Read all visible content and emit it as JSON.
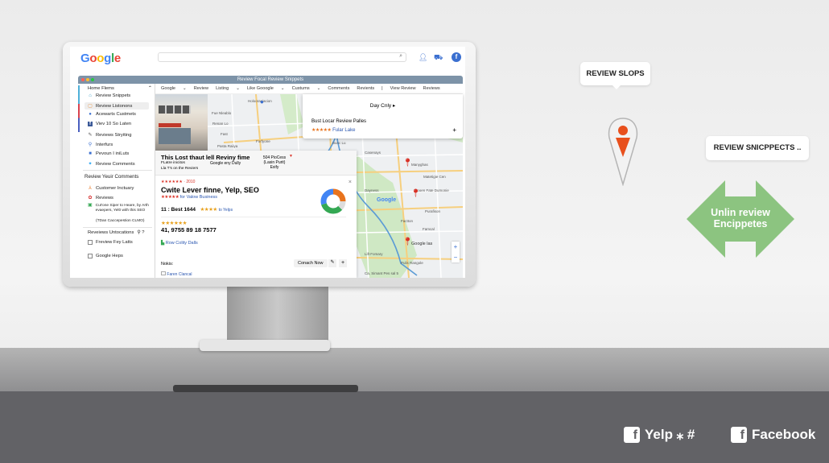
{
  "browser": {
    "logo": "Google",
    "search_placeholder": "",
    "icons": [
      "search-icon",
      "user-icon",
      "cart-icon",
      "facebook-icon"
    ]
  },
  "window": {
    "title": "Review Focal Review Snippets"
  },
  "sidebar": {
    "header": "Home Flems",
    "items": [
      {
        "label": "Review Snippets",
        "icon": "home-icon"
      },
      {
        "label": "Review Listonons",
        "icon": "list-icon",
        "selected": true
      },
      {
        "label": "Acewarts Custmets",
        "icon": "globe-icon"
      },
      {
        "label": "Viev 10 So Laten",
        "icon": "facebook-icon"
      },
      {
        "label": "Reviews Stryiting",
        "icon": "pen-icon"
      },
      {
        "label": "Interfurs",
        "icon": "user-icon"
      },
      {
        "label": "Pevoun I iniLuts",
        "icon": "briefcase-icon"
      },
      {
        "label": "Review Comments",
        "icon": "twitter-icon"
      }
    ],
    "section2": {
      "title": "Review Yeuir Comments",
      "items": [
        {
          "label": "Customer Inctuary",
          "icon": "person-icon"
        },
        {
          "label": "Reviews",
          "icon": "yelp-icon"
        },
        {
          "label": "Cut'one Siper to Heare, by Arth evaepers, Yel0 with this SEO",
          "icon": "image-icon"
        },
        {
          "label": "(TDan Caccepestion CLMO)"
        }
      ]
    },
    "section3": {
      "title": "Reveiews Untocations",
      "items": [
        {
          "label": "Freview Fey Latts",
          "checked": false
        },
        {
          "label": "Google Heps",
          "checked": false
        }
      ]
    }
  },
  "toolbar": [
    "Google",
    "Review",
    "Listing",
    "Like Gooogle",
    "Custums",
    "Comments",
    "Revients",
    "|",
    "View Review",
    "Reviews"
  ],
  "card": {
    "title": "Day Cnly ▸",
    "subtitle": "Bust Locar Review Palles",
    "rating": "★★★★★",
    "link": "Fular Lake",
    "plus": "+"
  },
  "panel": {
    "header": {
      "title": "This Lost thaut lell Reviny fime",
      "line1": "FLatre inicitos",
      "line2": "Lla T's on the Reviers",
      "mid": "Google eny Dully",
      "right1": "504 PioCess",
      "right2": "(Lasin Purit)",
      "right3": "Exify"
    },
    "rating_line": "★★★★★★ · 2010",
    "title": "Cwite Lever finne, Yelp, SEO",
    "stars1": "★★★★★",
    "link1": "for Valow Business",
    "count": "11 : Best 1644",
    "stars2": "★★★★",
    "link2": "to Yelps",
    "stars3": "★★★★★★",
    "phone": "41, 9755 89 18 7577",
    "link3": "Row Colity Dalls",
    "notes_label": "Nokis:",
    "button": "Conach Now",
    "footer_link": "Faren Clancal",
    "close": "×",
    "donut": [
      {
        "color": "#e8731d",
        "value": 25
      },
      {
        "color": "#dddddd",
        "value": 12
      },
      {
        "color": "#34a853",
        "value": 33
      },
      {
        "color": "#4285f4",
        "value": 30
      }
    ]
  },
  "map": {
    "labels": [
      "Holooraciacion",
      "Fue Nleablo",
      "Renan Lo",
      "Fast",
      "Pasta Raiiya",
      "Forfyone",
      "Bunc Lu",
      "Casenays",
      "Manyghas",
      "Matetigie Cen",
      "Dayness",
      "Dooen Fate Dumonie",
      "Google",
      "Purafison",
      "Factton",
      "Famcal",
      "Google las",
      "Lift Fomary",
      "Pulis Rangole",
      "Ca, Simant Pes sal 5"
    ],
    "zoom_in": "+",
    "zoom_out": "−"
  },
  "callouts": {
    "bubble1": "REVIEW SLOPS",
    "bubble2": "REVIEW SNICPPECTS ..",
    "arrow": "Unlin review Encippetes"
  },
  "footer": {
    "yelp": "Yelp ⁎ #",
    "facebook": "Facebook"
  }
}
